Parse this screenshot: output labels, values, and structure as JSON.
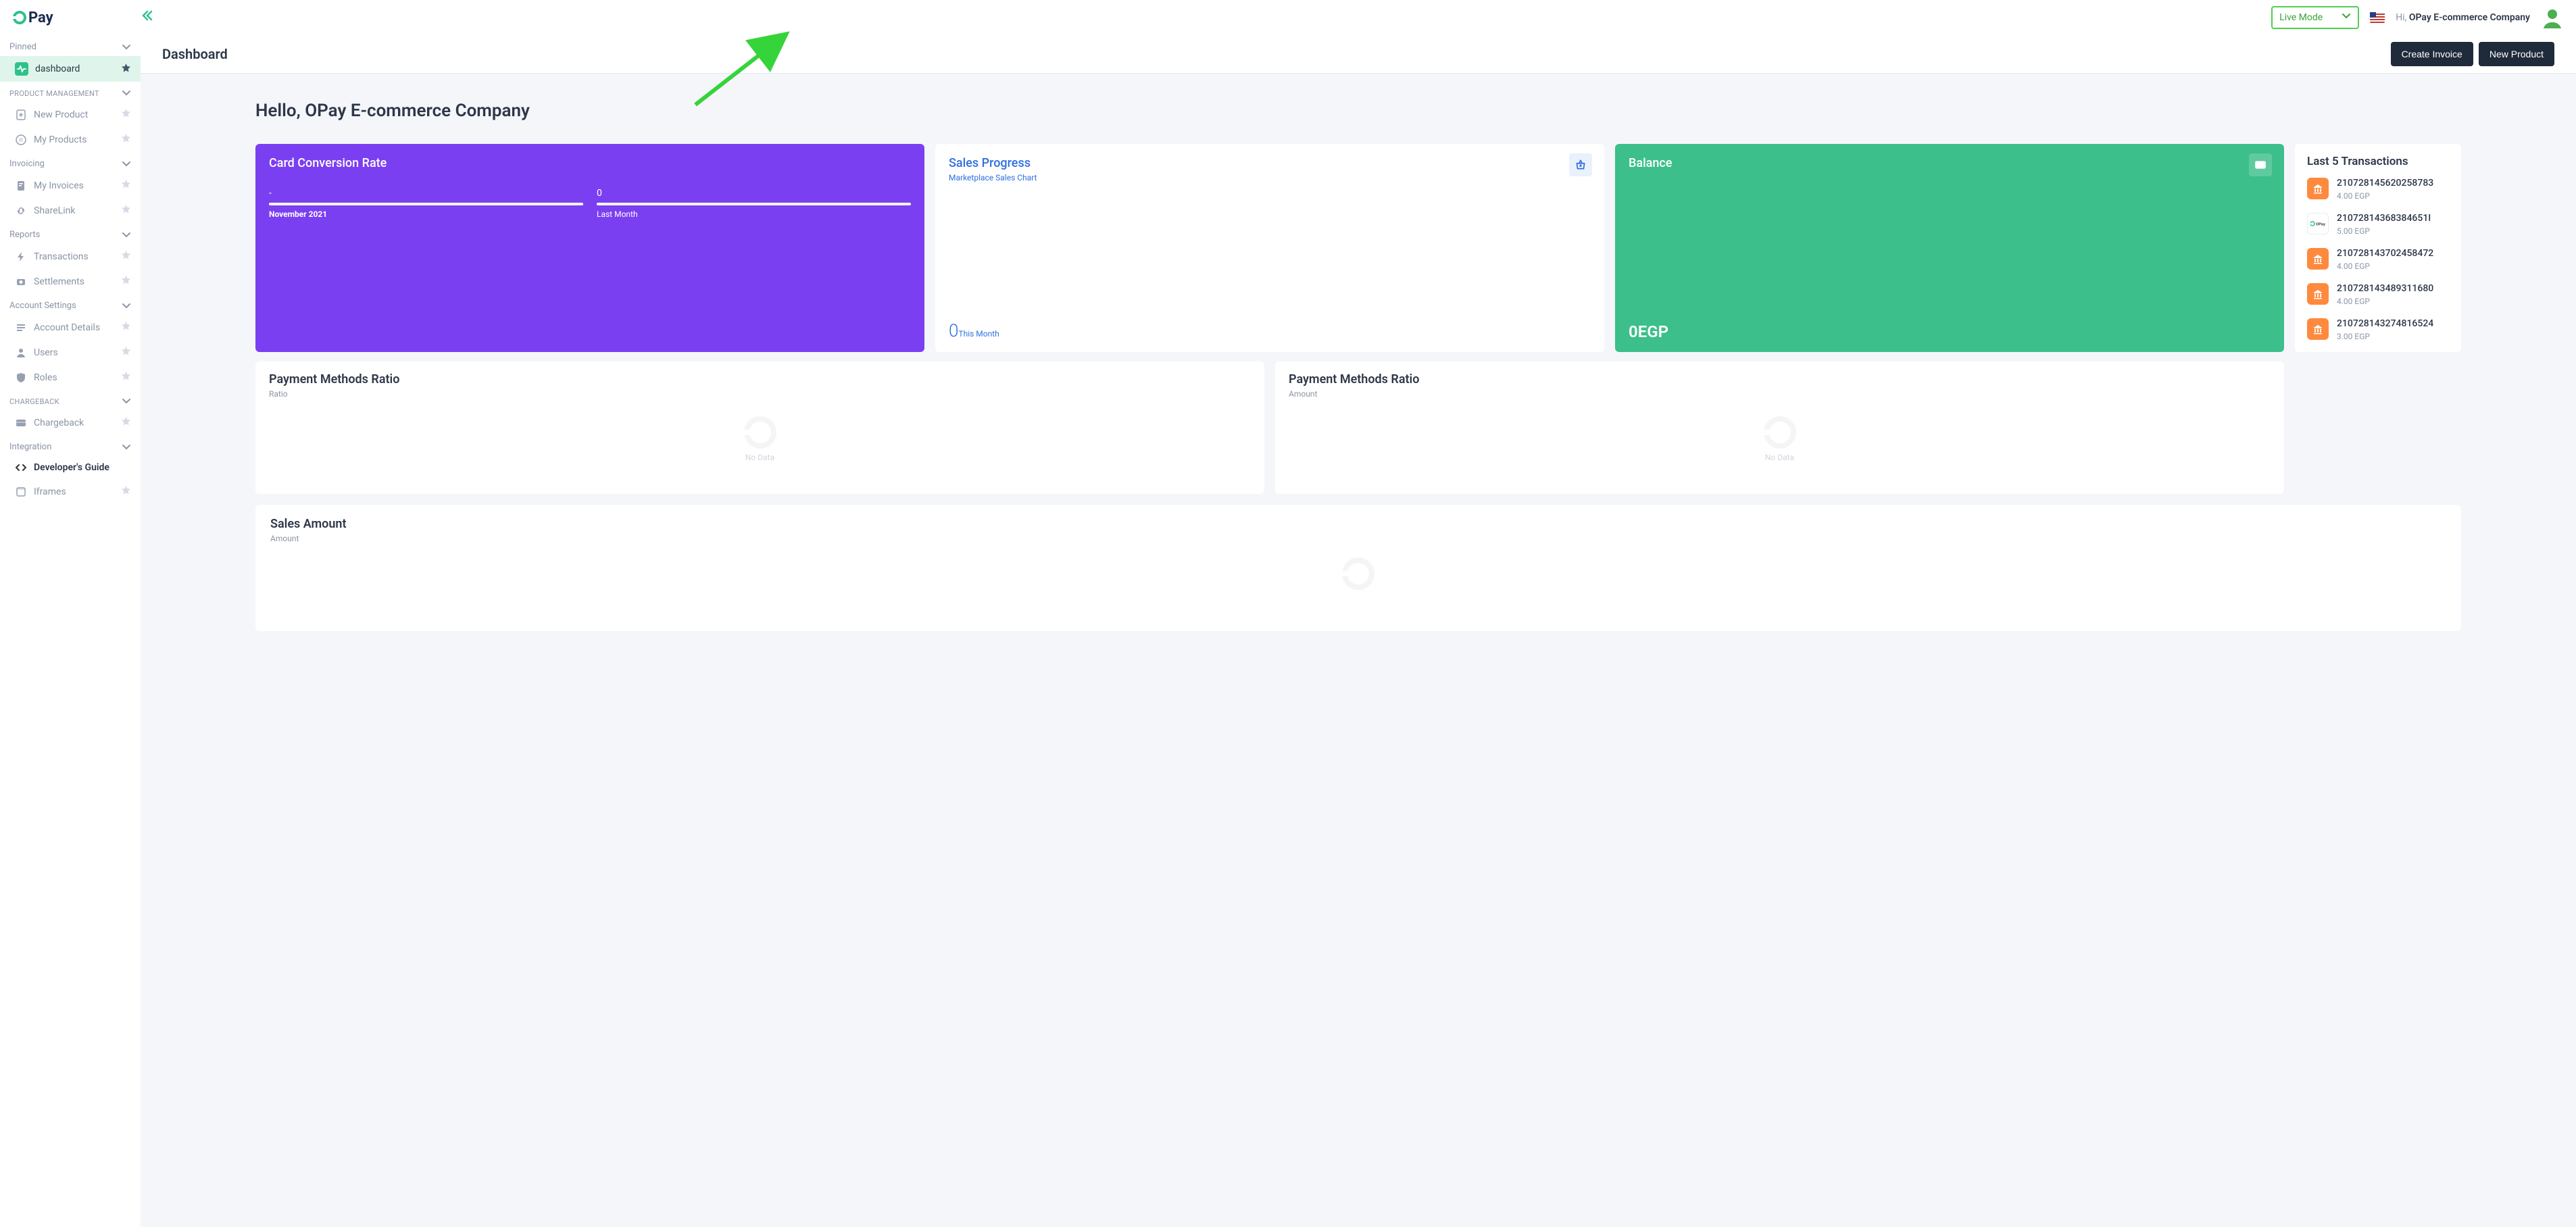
{
  "header": {
    "brand_main": "Pay",
    "mode_label": "Live Mode",
    "greeting_prefix": "Hi, ",
    "company_name": "OPay E-commerce Company"
  },
  "sidebar": {
    "sections": {
      "pinned": {
        "label": "Pinned"
      },
      "product_management": {
        "label": "PRODUCT MANAGEMENT"
      },
      "invoicing": {
        "label": "Invoicing"
      },
      "reports": {
        "label": "Reports"
      },
      "account_settings": {
        "label": "Account Settings"
      },
      "chargeback": {
        "label": "CHARGEBACK"
      },
      "integration": {
        "label": "Integration"
      }
    },
    "items": {
      "dashboard": "dashboard",
      "new_product": "New Product",
      "my_products": "My Products",
      "my_invoices": "My Invoices",
      "sharelink": "ShareLink",
      "transactions": "Transactions",
      "settlements": "Settlements",
      "account_details": "Account Details",
      "users": "Users",
      "roles": "Roles",
      "chargeback": "Chargeback",
      "developers_guide": "Developer's Guide",
      "iframes": "Iframes"
    }
  },
  "page": {
    "title": "Dashboard",
    "actions": {
      "create_invoice": "Create Invoice",
      "new_product": "New Product"
    },
    "hello_prefix": "Hello, ",
    "hello_name": "OPay E-commerce Company"
  },
  "cards": {
    "conversion": {
      "title": "Card Conversion Rate",
      "left_val": "-",
      "left_lbl": "November 2021",
      "right_val": "0",
      "right_lbl": "Last Month"
    },
    "sales": {
      "title": "Sales Progress",
      "subtitle": "Marketplace Sales Chart",
      "value": "0",
      "period": "This Month"
    },
    "balance": {
      "title": "Balance",
      "value": "0EGP"
    }
  },
  "panels": {
    "pm_ratio": {
      "title": "Payment Methods Ratio",
      "sub": "Ratio",
      "nodata": "No Data"
    },
    "pm_amount": {
      "title": "Payment Methods Ratio",
      "sub": "Amount",
      "nodata": "No Data"
    },
    "sales_amount": {
      "title": "Sales Amount",
      "sub": "Amount"
    }
  },
  "transactions": {
    "title": "Last 5 Transactions",
    "rows": [
      {
        "id": "210728145620258783",
        "amount": "4.00 EGP",
        "icon": "bank"
      },
      {
        "id": "21072814368384651I",
        "amount": "5.00 EGP",
        "icon": "opay"
      },
      {
        "id": "210728143702458472",
        "amount": "4.00 EGP",
        "icon": "bank"
      },
      {
        "id": "210728143489311680",
        "amount": "4.00 EGP",
        "icon": "bank"
      },
      {
        "id": "210728143274816524",
        "amount": "3.00 EGP",
        "icon": "bank"
      }
    ]
  }
}
